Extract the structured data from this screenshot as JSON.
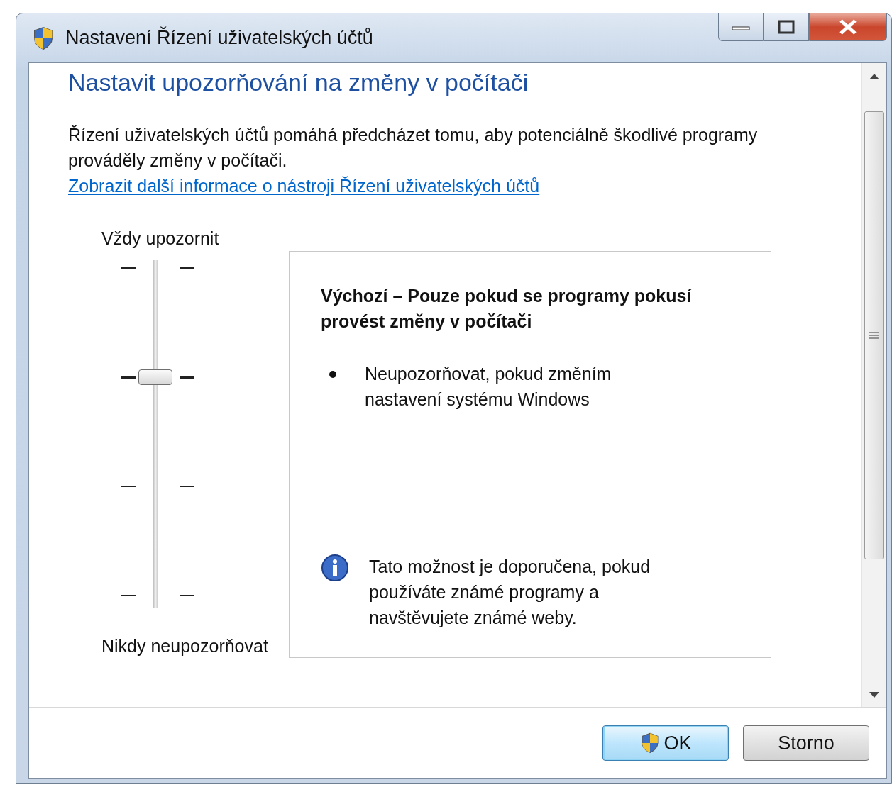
{
  "window": {
    "title": "Nastavení Řízení uživatelských účtů"
  },
  "heading": "Nastavit upozorňování na změny v počítači",
  "description": "Řízení uživatelských účtů pomáhá předcházet tomu, aby potenciálně škodlivé programy prováděly změny v počítači.",
  "link": "Zobrazit další informace o nástroji Řízení uživatelských účtů",
  "slider": {
    "top_label": "Vždy upozornit",
    "bottom_label": "Nikdy neupozorňovat",
    "level": 0.667
  },
  "description_box": {
    "title": "Výchozí – Pouze pokud se programy pokusí provést změny v počítači",
    "bullets": [
      "Neupozorňovat, pokud změním nastavení systému Windows"
    ],
    "info": "Tato možnost je doporučena, pokud používáte známé programy a navštěvujete známé weby."
  },
  "buttons": [
    {
      "label": "OK",
      "kind": "shield",
      "default": true
    },
    {
      "label": "Storno",
      "kind": "plain",
      "default": false
    }
  ]
}
